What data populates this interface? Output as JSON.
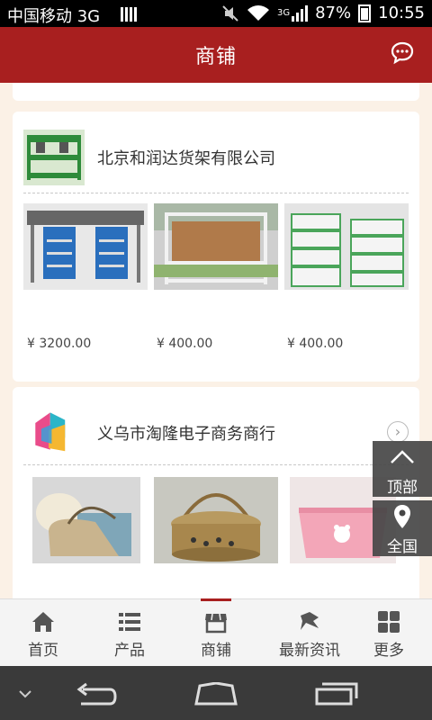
{
  "status_bar": {
    "carrier": "中国移动 3G",
    "battery": "87%",
    "time": "10:55",
    "network": "3G"
  },
  "header": {
    "title": "商铺"
  },
  "shops": [
    {
      "name": "北京和润达货架有限公司",
      "products": [
        {
          "price": "¥ 3200.00"
        },
        {
          "price": "¥ 400.00"
        },
        {
          "price": "¥ 400.00"
        }
      ]
    },
    {
      "name": "义乌市淘隆电子商务商行",
      "products": [
        {},
        {},
        {}
      ]
    }
  ],
  "float_buttons": {
    "top": "顶部",
    "all": "全国"
  },
  "tabs": [
    {
      "label": "首页",
      "icon": "home-icon"
    },
    {
      "label": "产品",
      "icon": "list-icon"
    },
    {
      "label": "商铺",
      "icon": "shop-icon",
      "active": true
    },
    {
      "label": "最新资讯",
      "icon": "news-icon"
    },
    {
      "label": "更多",
      "icon": "grid-icon"
    }
  ],
  "colors": {
    "brand": "#a81f1f",
    "page_bg": "#fbf1e6"
  }
}
